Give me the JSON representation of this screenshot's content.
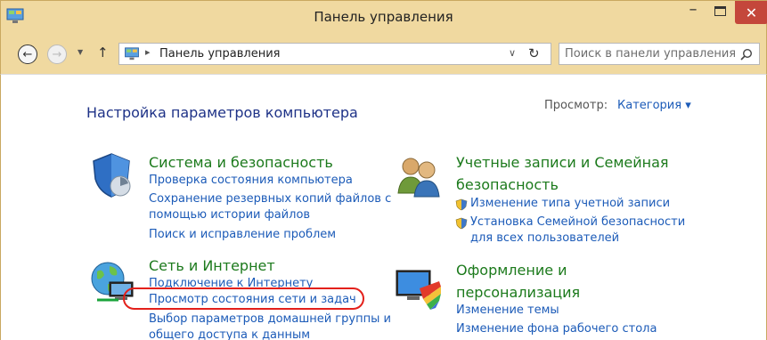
{
  "window": {
    "title": "Панель управления",
    "minimize": "–",
    "close": "✕"
  },
  "nav": {
    "back": "←",
    "forward": "→",
    "recent": "▼",
    "up": "↑",
    "path_separator": "▸",
    "path": "Панель управления",
    "address_dropdown": "∨",
    "refresh": "↻",
    "search_placeholder": "Поиск в панели управления"
  },
  "page": {
    "title": "Настройка параметров компьютера",
    "view_label": "Просмотр:",
    "view_value": "Категория ▾"
  },
  "categories": {
    "system": {
      "title": "Система и безопасность",
      "links": [
        "Проверка состояния компьютера",
        "Сохранение резервных копий файлов с",
        "помощью истории файлов",
        "Поиск и исправление проблем"
      ]
    },
    "accounts": {
      "title_line1": "Учетные записи и Семейная",
      "title_line2": "безопасность",
      "links": [
        "Изменение типа учетной записи",
        "Установка Семейной безопасности",
        "для всех пользователей"
      ]
    },
    "network": {
      "title": "Сеть и Интернет",
      "links": [
        "Подключение к Интернету",
        "Просмотр состояния сети и задач",
        "Выбор параметров домашней группы и",
        "общего доступа к данным"
      ]
    },
    "appearance": {
      "title_line1": "Оформление и",
      "title_line2": "персонализация",
      "links": [
        "Изменение темы",
        "Изменение фона рабочего стола"
      ]
    }
  },
  "colors": {
    "titlebar": "#f0d9a0",
    "close_button": "#c4473b",
    "link": "#1c5bb8",
    "category_heading": "#1c7a1c",
    "highlight": "#e3201b"
  }
}
